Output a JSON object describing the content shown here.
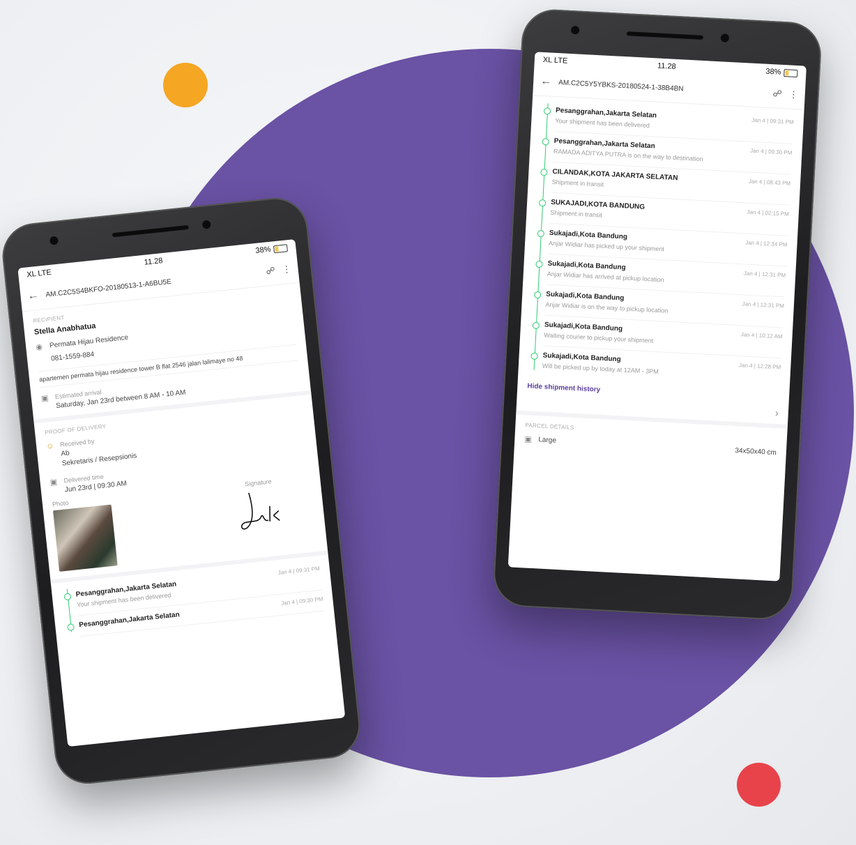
{
  "colors": {
    "purple": "#6a52a4",
    "orange": "#f5a622",
    "red": "#e8434b",
    "timeline_green": "#2ecc71"
  },
  "left_phone": {
    "status": {
      "carrier": "XL LTE",
      "time": "11.28",
      "battery": "38%"
    },
    "appbar": {
      "tracking": "AM.C2C5S4BKFO-20180513-1-A6BU5E"
    },
    "recipient": {
      "section_label": "Recipient",
      "name": "Stella Anabhatua",
      "place": "Permata Hijau Residence",
      "phone": "081-1559-884",
      "note": "apartemen permata hijau residence tower B flat 2546 jalan lalimaye no 48",
      "arrival_label": "Estimated arrival",
      "arrival_value": "Saturday, Jan 23rd between 8 AM - 10 AM"
    },
    "proof": {
      "section_label": "Proof of delivery",
      "receiver_label": "Received by",
      "receiver_name": "Ab",
      "receiver_role": "Sekretaris / Resepsionis",
      "time_label": "Delivered time",
      "time_value": "Jun 23rd | 09:30 AM",
      "photo_label": "Photo",
      "signature_label": "Signature",
      "signature_text": "Jak"
    },
    "history": [
      {
        "location": "Pesanggrahan,Jakarta Selatan",
        "time": "Jan 4 | 09:31 PM",
        "desc": "Your shipment has been delivered"
      },
      {
        "location": "Pesanggrahan,Jakarta Selatan",
        "time": "Jan 4 | 09:30 PM",
        "desc": ""
      }
    ]
  },
  "right_phone": {
    "status": {
      "carrier": "XL LTE",
      "time": "11.28",
      "battery": "38%"
    },
    "appbar": {
      "tracking": "AM.C2C5Y5YBKS-20180524-1-38B4BN"
    },
    "history": [
      {
        "location": "Pesanggrahan,Jakarta Selatan",
        "time": "Jan 4 | 09:31 PM",
        "desc": "Your shipment has been delivered"
      },
      {
        "location": "Pesanggrahan,Jakarta Selatan",
        "time": "Jan 4 | 09:30 PM",
        "desc": "RAMADA ADITYA PUTRA is on the way to destination"
      },
      {
        "location": "CILANDAK,KOTA JAKARTA SELATAN",
        "time": "Jan 4 | 08:43 PM",
        "desc": "Shipment in transit"
      },
      {
        "location": "SUKAJADI,KOTA BANDUNG",
        "time": "Jan 4 | 02:15 PM",
        "desc": "Shipment in transit"
      },
      {
        "location": "Sukajadi,Kota Bandung",
        "time": "Jan 4 | 12:34 PM",
        "desc": "Anjar Widiar has picked up your shipment"
      },
      {
        "location": "Sukajadi,Kota Bandung",
        "time": "Jan 4 | 12:31 PM",
        "desc": "Anjar Widiar has arrived at pickup location"
      },
      {
        "location": "Sukajadi,Kota Bandung",
        "time": "Jan 4 | 12:31 PM",
        "desc": "Anjar Widiar is on the way to pickup location"
      },
      {
        "location": "Sukajadi,Kota Bandung",
        "time": "Jan 4 | 10:12 AM",
        "desc": "Waiting courier to pickup your shipment"
      },
      {
        "location": "Sukajadi,Kota Bandung",
        "time": "Jan 4 | 12:28 PM",
        "desc": "Will be picked up by today at 12AM - 3PM"
      }
    ],
    "hide_link": "Hide shipment history",
    "parcel": {
      "section_label": "Parcel details",
      "size": "Large",
      "dimensions": "34x50x40 cm"
    }
  }
}
